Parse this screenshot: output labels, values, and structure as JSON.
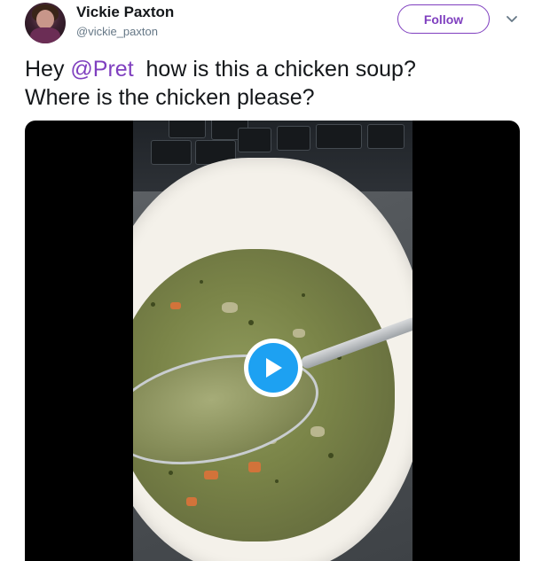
{
  "author": {
    "name": "Vickie Paxton",
    "handle": "@vickie_paxton"
  },
  "follow_label": "Follow",
  "tweet": {
    "prefix": "Hey ",
    "mention": "@Pret",
    "rest_line1": "  how is this a chicken soup?",
    "line2": "Where is the chicken please?"
  },
  "colors": {
    "accent": "#7f3fbf",
    "play_button": "#1da1f2",
    "text": "#14171a",
    "secondary_text": "#657786"
  },
  "icons": {
    "caret": "chevron-down-icon",
    "play": "play-icon"
  }
}
